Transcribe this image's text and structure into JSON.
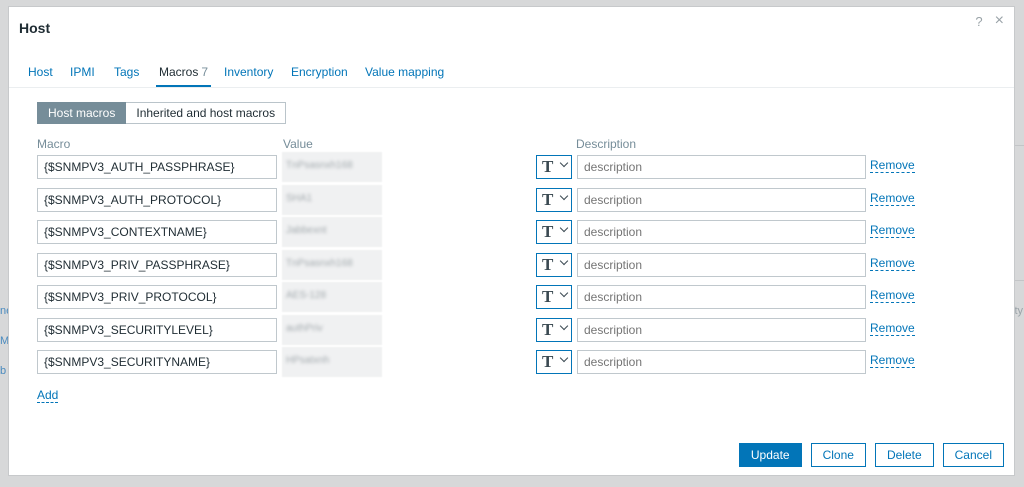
{
  "background": {
    "fragments": [
      "ne",
      "M",
      "b",
      "ity"
    ]
  },
  "dialog": {
    "title": "Host",
    "help_icon": "?",
    "close_icon": "×"
  },
  "tabs": [
    {
      "label": "Host"
    },
    {
      "label": "IPMI"
    },
    {
      "label": "Tags"
    },
    {
      "label": "Macros",
      "count": "7",
      "active": true
    },
    {
      "label": "Inventory"
    },
    {
      "label": "Encryption"
    },
    {
      "label": "Value mapping"
    }
  ],
  "macro_view": {
    "host_macros": "Host macros",
    "inherited_macros": "Inherited and host macros"
  },
  "columns": {
    "macro": "Macro",
    "value": "Value",
    "description": "Description"
  },
  "macros": [
    {
      "macro": "{$SNMPV3_AUTH_PASSPHRASE}",
      "value": "TnPsasnxh168",
      "description_placeholder": "description",
      "remove": "Remove"
    },
    {
      "macro": "{$SNMPV3_AUTH_PROTOCOL}",
      "value": "SHA1",
      "description_placeholder": "description",
      "remove": "Remove"
    },
    {
      "macro": "{$SNMPV3_CONTEXTNAME}",
      "value": "Jabbexnt",
      "description_placeholder": "description",
      "remove": "Remove"
    },
    {
      "macro": "{$SNMPV3_PRIV_PASSPHRASE}",
      "value": "TnPsasnxh168",
      "description_placeholder": "description",
      "remove": "Remove"
    },
    {
      "macro": "{$SNMPV3_PRIV_PROTOCOL}",
      "value": "AES-128",
      "description_placeholder": "description",
      "remove": "Remove"
    },
    {
      "macro": "{$SNMPV3_SECURITYLEVEL}",
      "value": "authPriv",
      "description_placeholder": "description",
      "remove": "Remove"
    },
    {
      "macro": "{$SNMPV3_SECURITYNAME}",
      "value": "HPsatxnh",
      "description_placeholder": "description",
      "remove": "Remove"
    }
  ],
  "type_button_icon": "T",
  "add_label": "Add",
  "footer": {
    "update": "Update",
    "clone": "Clone",
    "delete": "Delete",
    "cancel": "Cancel"
  },
  "colors": {
    "accent": "#0275b8",
    "active_segment": "#768d99"
  }
}
